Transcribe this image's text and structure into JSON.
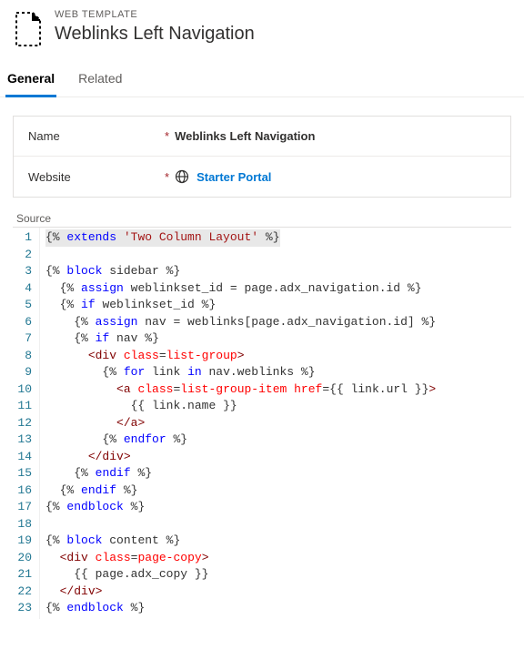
{
  "header": {
    "eyebrow": "WEB TEMPLATE",
    "title": "Weblinks Left Navigation"
  },
  "tabs": [
    {
      "label": "General",
      "active": true
    },
    {
      "label": "Related",
      "active": false
    }
  ],
  "form": {
    "name_label": "Name",
    "name_value": "Weblinks Left Navigation",
    "website_label": "Website",
    "website_value": "Starter Portal"
  },
  "source_label": "Source",
  "code_lines": [
    [
      {
        "t": "{%",
        "c": "tok-delim",
        "hl": true
      },
      {
        "t": " ",
        "c": "",
        "hl": true
      },
      {
        "t": "extends",
        "c": "tok-kw",
        "hl": true
      },
      {
        "t": " ",
        "c": "",
        "hl": true
      },
      {
        "t": "'Two Column Layout'",
        "c": "tok-str",
        "hl": true
      },
      {
        "t": " ",
        "c": "",
        "hl": true
      },
      {
        "t": "%}",
        "c": "tok-delim",
        "hl": true
      }
    ],
    [],
    [
      {
        "t": "{%",
        "c": "tok-delim"
      },
      {
        "t": " ",
        "c": ""
      },
      {
        "t": "block",
        "c": "tok-kw"
      },
      {
        "t": " sidebar ",
        "c": ""
      },
      {
        "t": "%}",
        "c": "tok-delim"
      }
    ],
    [
      {
        "t": "  ",
        "c": ""
      },
      {
        "t": "{%",
        "c": "tok-delim"
      },
      {
        "t": " ",
        "c": ""
      },
      {
        "t": "assign",
        "c": "tok-kw"
      },
      {
        "t": " weblinkset_id = page.adx_navigation.id ",
        "c": ""
      },
      {
        "t": "%}",
        "c": "tok-delim"
      }
    ],
    [
      {
        "t": "  ",
        "c": ""
      },
      {
        "t": "{%",
        "c": "tok-delim"
      },
      {
        "t": " ",
        "c": ""
      },
      {
        "t": "if",
        "c": "tok-kw"
      },
      {
        "t": " weblinkset_id ",
        "c": ""
      },
      {
        "t": "%}",
        "c": "tok-delim"
      }
    ],
    [
      {
        "t": "    ",
        "c": ""
      },
      {
        "t": "{%",
        "c": "tok-delim"
      },
      {
        "t": " ",
        "c": ""
      },
      {
        "t": "assign",
        "c": "tok-kw"
      },
      {
        "t": " nav = weblinks[page.adx_navigation.id] ",
        "c": ""
      },
      {
        "t": "%}",
        "c": "tok-delim"
      }
    ],
    [
      {
        "t": "    ",
        "c": ""
      },
      {
        "t": "{%",
        "c": "tok-delim"
      },
      {
        "t": " ",
        "c": ""
      },
      {
        "t": "if",
        "c": "tok-kw"
      },
      {
        "t": " nav ",
        "c": ""
      },
      {
        "t": "%}",
        "c": "tok-delim"
      }
    ],
    [
      {
        "t": "      ",
        "c": ""
      },
      {
        "t": "<",
        "c": "tok-tag"
      },
      {
        "t": "div",
        "c": "tok-tag"
      },
      {
        "t": " ",
        "c": ""
      },
      {
        "t": "class",
        "c": "tok-attr"
      },
      {
        "t": "=",
        "c": "tok-eq"
      },
      {
        "t": "list-group",
        "c": "tok-attrval"
      },
      {
        "t": ">",
        "c": "tok-tag"
      }
    ],
    [
      {
        "t": "        ",
        "c": ""
      },
      {
        "t": "{%",
        "c": "tok-delim"
      },
      {
        "t": " ",
        "c": ""
      },
      {
        "t": "for",
        "c": "tok-kw"
      },
      {
        "t": " link ",
        "c": ""
      },
      {
        "t": "in",
        "c": "tok-kw"
      },
      {
        "t": " nav.weblinks ",
        "c": ""
      },
      {
        "t": "%}",
        "c": "tok-delim"
      }
    ],
    [
      {
        "t": "          ",
        "c": ""
      },
      {
        "t": "<",
        "c": "tok-tag"
      },
      {
        "t": "a",
        "c": "tok-tag"
      },
      {
        "t": " ",
        "c": ""
      },
      {
        "t": "class",
        "c": "tok-attr"
      },
      {
        "t": "=",
        "c": "tok-eq"
      },
      {
        "t": "list-group-item",
        "c": "tok-attrval"
      },
      {
        "t": " ",
        "c": ""
      },
      {
        "t": "href",
        "c": "tok-attr"
      },
      {
        "t": "=",
        "c": "tok-eq"
      },
      {
        "t": "{{",
        "c": "tok-out"
      },
      {
        "t": " link.url ",
        "c": ""
      },
      {
        "t": "}}",
        "c": "tok-out"
      },
      {
        "t": ">",
        "c": "tok-tag"
      }
    ],
    [
      {
        "t": "            ",
        "c": ""
      },
      {
        "t": "{{",
        "c": "tok-out"
      },
      {
        "t": " link.name ",
        "c": ""
      },
      {
        "t": "}}",
        "c": "tok-out"
      }
    ],
    [
      {
        "t": "          ",
        "c": ""
      },
      {
        "t": "</",
        "c": "tok-tag"
      },
      {
        "t": "a",
        "c": "tok-tag"
      },
      {
        "t": ">",
        "c": "tok-tag"
      }
    ],
    [
      {
        "t": "        ",
        "c": ""
      },
      {
        "t": "{%",
        "c": "tok-delim"
      },
      {
        "t": " ",
        "c": ""
      },
      {
        "t": "endfor",
        "c": "tok-kw"
      },
      {
        "t": " ",
        "c": ""
      },
      {
        "t": "%}",
        "c": "tok-delim"
      }
    ],
    [
      {
        "t": "      ",
        "c": ""
      },
      {
        "t": "</",
        "c": "tok-tag"
      },
      {
        "t": "div",
        "c": "tok-tag"
      },
      {
        "t": ">",
        "c": "tok-tag"
      }
    ],
    [
      {
        "t": "    ",
        "c": ""
      },
      {
        "t": "{%",
        "c": "tok-delim"
      },
      {
        "t": " ",
        "c": ""
      },
      {
        "t": "endif",
        "c": "tok-kw"
      },
      {
        "t": " ",
        "c": ""
      },
      {
        "t": "%}",
        "c": "tok-delim"
      }
    ],
    [
      {
        "t": "  ",
        "c": ""
      },
      {
        "t": "{%",
        "c": "tok-delim"
      },
      {
        "t": " ",
        "c": ""
      },
      {
        "t": "endif",
        "c": "tok-kw"
      },
      {
        "t": " ",
        "c": ""
      },
      {
        "t": "%}",
        "c": "tok-delim"
      }
    ],
    [
      {
        "t": "{%",
        "c": "tok-delim"
      },
      {
        "t": " ",
        "c": ""
      },
      {
        "t": "endblock",
        "c": "tok-kw"
      },
      {
        "t": " ",
        "c": ""
      },
      {
        "t": "%}",
        "c": "tok-delim"
      }
    ],
    [],
    [
      {
        "t": "{%",
        "c": "tok-delim"
      },
      {
        "t": " ",
        "c": ""
      },
      {
        "t": "block",
        "c": "tok-kw"
      },
      {
        "t": " content ",
        "c": ""
      },
      {
        "t": "%}",
        "c": "tok-delim"
      }
    ],
    [
      {
        "t": "  ",
        "c": ""
      },
      {
        "t": "<",
        "c": "tok-tag"
      },
      {
        "t": "div",
        "c": "tok-tag"
      },
      {
        "t": " ",
        "c": ""
      },
      {
        "t": "class",
        "c": "tok-attr"
      },
      {
        "t": "=",
        "c": "tok-eq"
      },
      {
        "t": "page-copy",
        "c": "tok-attrval"
      },
      {
        "t": ">",
        "c": "tok-tag"
      }
    ],
    [
      {
        "t": "    ",
        "c": ""
      },
      {
        "t": "{{",
        "c": "tok-out"
      },
      {
        "t": " page.adx_copy ",
        "c": ""
      },
      {
        "t": "}}",
        "c": "tok-out"
      }
    ],
    [
      {
        "t": "  ",
        "c": ""
      },
      {
        "t": "</",
        "c": "tok-tag"
      },
      {
        "t": "div",
        "c": "tok-tag"
      },
      {
        "t": ">",
        "c": "tok-tag"
      }
    ],
    [
      {
        "t": "{%",
        "c": "tok-delim"
      },
      {
        "t": " ",
        "c": ""
      },
      {
        "t": "endblock",
        "c": "tok-kw"
      },
      {
        "t": " ",
        "c": ""
      },
      {
        "t": "%}",
        "c": "tok-delim"
      }
    ]
  ]
}
